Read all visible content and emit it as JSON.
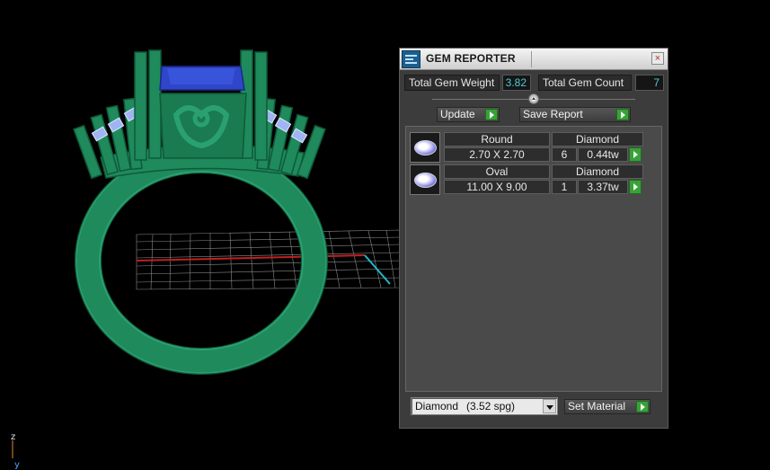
{
  "viewport": {
    "axis_z": "z",
    "axis_y": "y",
    "colors": {
      "ring": "#1f8a5c",
      "ring_edge": "#0e5a38",
      "center_stone": "#2f46c9",
      "grid": "#8a8a8a",
      "x_axis": "#c02020",
      "y_axis": "#20b8c8"
    }
  },
  "panel": {
    "title": "GEM REPORTER",
    "close_glyph": "×",
    "totals": {
      "weight_label": "Total Gem Weight",
      "weight_value": "3.82",
      "count_label": "Total Gem Count",
      "count_value": "7"
    },
    "update_label": "Update",
    "save_report_label": "Save Report",
    "gems": [
      {
        "shape": "Round",
        "material": "Diamond",
        "size": "2.70 X 2.70",
        "count": "6",
        "weight": "0.44tw"
      },
      {
        "shape": "Oval",
        "material": "Diamond",
        "size": "11.00 X 9.00",
        "count": "1",
        "weight": "3.37tw"
      }
    ],
    "material_select": {
      "name": "Diamond",
      "sg": "(3.52 spg)"
    },
    "set_material_label": "Set Material",
    "accent_green": "#3aa03a",
    "value_color": "#4ccbd6"
  }
}
